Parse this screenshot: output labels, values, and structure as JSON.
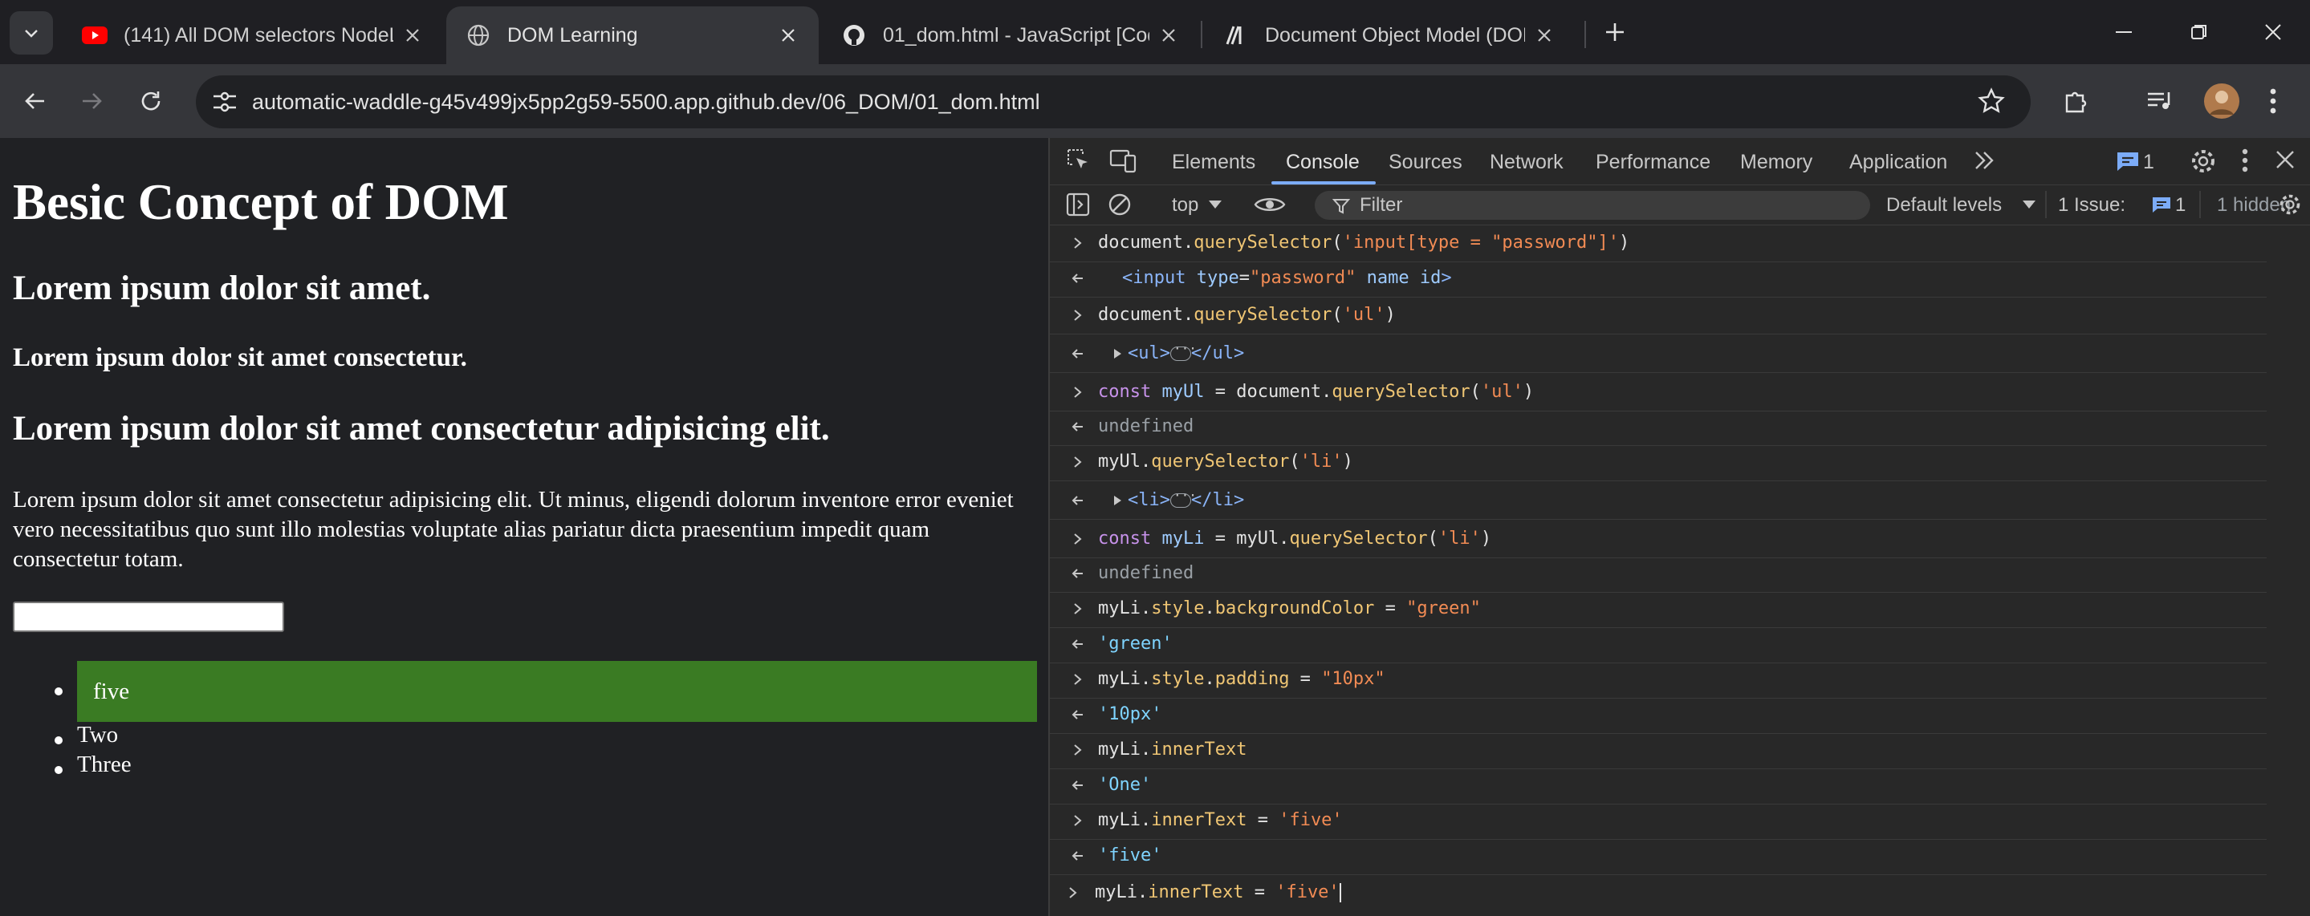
{
  "browser": {
    "tabs": [
      {
        "title": "(141) All DOM selectors NodeLi",
        "favicon": "youtube-icon",
        "active": false
      },
      {
        "title": "DOM Learning",
        "favicon": "globe-icon",
        "active": true
      },
      {
        "title": "01_dom.html - JavaScript [Code",
        "favicon": "github-icon",
        "active": false
      },
      {
        "title": "Document Object Model (DOM",
        "favicon": "mdn-icon",
        "active": false
      }
    ],
    "url": "automatic-waddle-g45v499jx5pp2g59-5500.app.github.dev/06_DOM/01_dom.html"
  },
  "page": {
    "h1": "Besic Concept of DOM",
    "h2": "Lorem ipsum dolor sit amet.",
    "h4": "Lorem ipsum dolor sit amet consectetur.",
    "h2b": "Lorem ipsum dolor sit amet consectetur adipisicing elit.",
    "paragraph": "Lorem ipsum dolor sit amet consectetur adipisicing elit. Ut minus, eligendi dolorum inventore error eveniet vero necessitatibus quo sunt illo molestias voluptate alias pariatur dicta praesentium impedit quam consectetur totam.",
    "list": [
      "five",
      "Two",
      "Three"
    ],
    "highlight_color": "#3a7b23"
  },
  "devtools": {
    "tabs": [
      "Elements",
      "Console",
      "Sources",
      "Network",
      "Performance",
      "Memory",
      "Application"
    ],
    "active_tab": "Console",
    "messages_count": "1",
    "context": "top",
    "filter_placeholder": "Filter",
    "levels": "Default levels",
    "issues_label": "1 Issue:",
    "issues_count": "1",
    "hidden": "1 hidden",
    "console": [
      {
        "dir": "in",
        "tokens": [
          [
            "document.",
            ""
          ],
          [
            "querySelector",
            "f"
          ],
          [
            "(",
            ""
          ],
          [
            "'input[type = \"password\"]'",
            "s"
          ],
          [
            ")",
            ""
          ]
        ]
      },
      {
        "dir": "out",
        "tokens": [
          [
            "<input ",
            "tag"
          ],
          [
            "type",
            "attr"
          ],
          [
            "=",
            ""
          ],
          [
            "\"password\"",
            "attrv"
          ],
          [
            " name id",
            "attr"
          ],
          [
            ">",
            "tag"
          ]
        ],
        "indent": true
      },
      {
        "dir": "in",
        "tokens": [
          [
            "document.",
            ""
          ],
          [
            "querySelector",
            "f"
          ],
          [
            "(",
            ""
          ],
          [
            "'ul'",
            "s"
          ],
          [
            ")",
            ""
          ]
        ]
      },
      {
        "dir": "out",
        "expand": true,
        "tokens": [
          [
            "<ul>",
            "tag"
          ],
          [
            "ELLIPSIS",
            ""
          ],
          [
            "</ul>",
            "tag"
          ]
        ]
      },
      {
        "dir": "in",
        "tokens": [
          [
            "const ",
            "k"
          ],
          [
            "myUl",
            "v"
          ],
          [
            " = document.",
            ""
          ],
          [
            "querySelector",
            "f"
          ],
          [
            "(",
            ""
          ],
          [
            "'ul'",
            "s"
          ],
          [
            ")",
            ""
          ]
        ]
      },
      {
        "dir": "out",
        "tokens": [
          [
            "undefined",
            "u"
          ]
        ]
      },
      {
        "dir": "in",
        "tokens": [
          [
            "myUl.",
            ""
          ],
          [
            "querySelector",
            "f"
          ],
          [
            "(",
            ""
          ],
          [
            "'li'",
            "s"
          ],
          [
            ")",
            ""
          ]
        ]
      },
      {
        "dir": "out",
        "expand": true,
        "tokens": [
          [
            "<li>",
            "tag"
          ],
          [
            "ELLIPSIS",
            ""
          ],
          [
            "</li>",
            "tag"
          ]
        ]
      },
      {
        "dir": "in",
        "tokens": [
          [
            "const ",
            "k"
          ],
          [
            "myLi",
            "v"
          ],
          [
            " = myUl.",
            ""
          ],
          [
            "querySelector",
            "f"
          ],
          [
            "(",
            ""
          ],
          [
            "'li'",
            "s"
          ],
          [
            ")",
            ""
          ]
        ]
      },
      {
        "dir": "out",
        "tokens": [
          [
            "undefined",
            "u"
          ]
        ]
      },
      {
        "dir": "in",
        "tokens": [
          [
            "myLi.",
            ""
          ],
          [
            "style",
            "f"
          ],
          [
            ".",
            ""
          ],
          [
            "backgroundColor",
            "f"
          ],
          [
            " = ",
            ""
          ],
          [
            "\"green\"",
            "s"
          ]
        ]
      },
      {
        "dir": "out",
        "tokens": [
          [
            "'green'",
            "sv"
          ]
        ]
      },
      {
        "dir": "in",
        "tokens": [
          [
            "myLi.",
            ""
          ],
          [
            "style",
            "f"
          ],
          [
            ".",
            ""
          ],
          [
            "padding",
            "f"
          ],
          [
            " = ",
            ""
          ],
          [
            "\"10px\"",
            "s"
          ]
        ]
      },
      {
        "dir": "out",
        "tokens": [
          [
            "'10px'",
            "sv"
          ]
        ]
      },
      {
        "dir": "in",
        "tokens": [
          [
            "myLi.",
            ""
          ],
          [
            "innerText",
            "f"
          ]
        ]
      },
      {
        "dir": "out",
        "tokens": [
          [
            "'One'",
            "sv"
          ]
        ]
      },
      {
        "dir": "in",
        "tokens": [
          [
            "myLi.",
            ""
          ],
          [
            "innerText",
            "f"
          ],
          [
            " = ",
            ""
          ],
          [
            "'five'",
            "s"
          ]
        ]
      },
      {
        "dir": "out",
        "tokens": [
          [
            "'five'",
            "sv"
          ]
        ]
      }
    ],
    "prompt": [
      [
        "myLi.",
        ""
      ],
      [
        "innerText",
        "f"
      ],
      [
        " = ",
        ""
      ],
      [
        "'five'",
        "s"
      ]
    ],
    "colors": {
      "accent": "#7cacf8",
      "string": "#f28b54",
      "keyword": "#c792ea"
    }
  }
}
